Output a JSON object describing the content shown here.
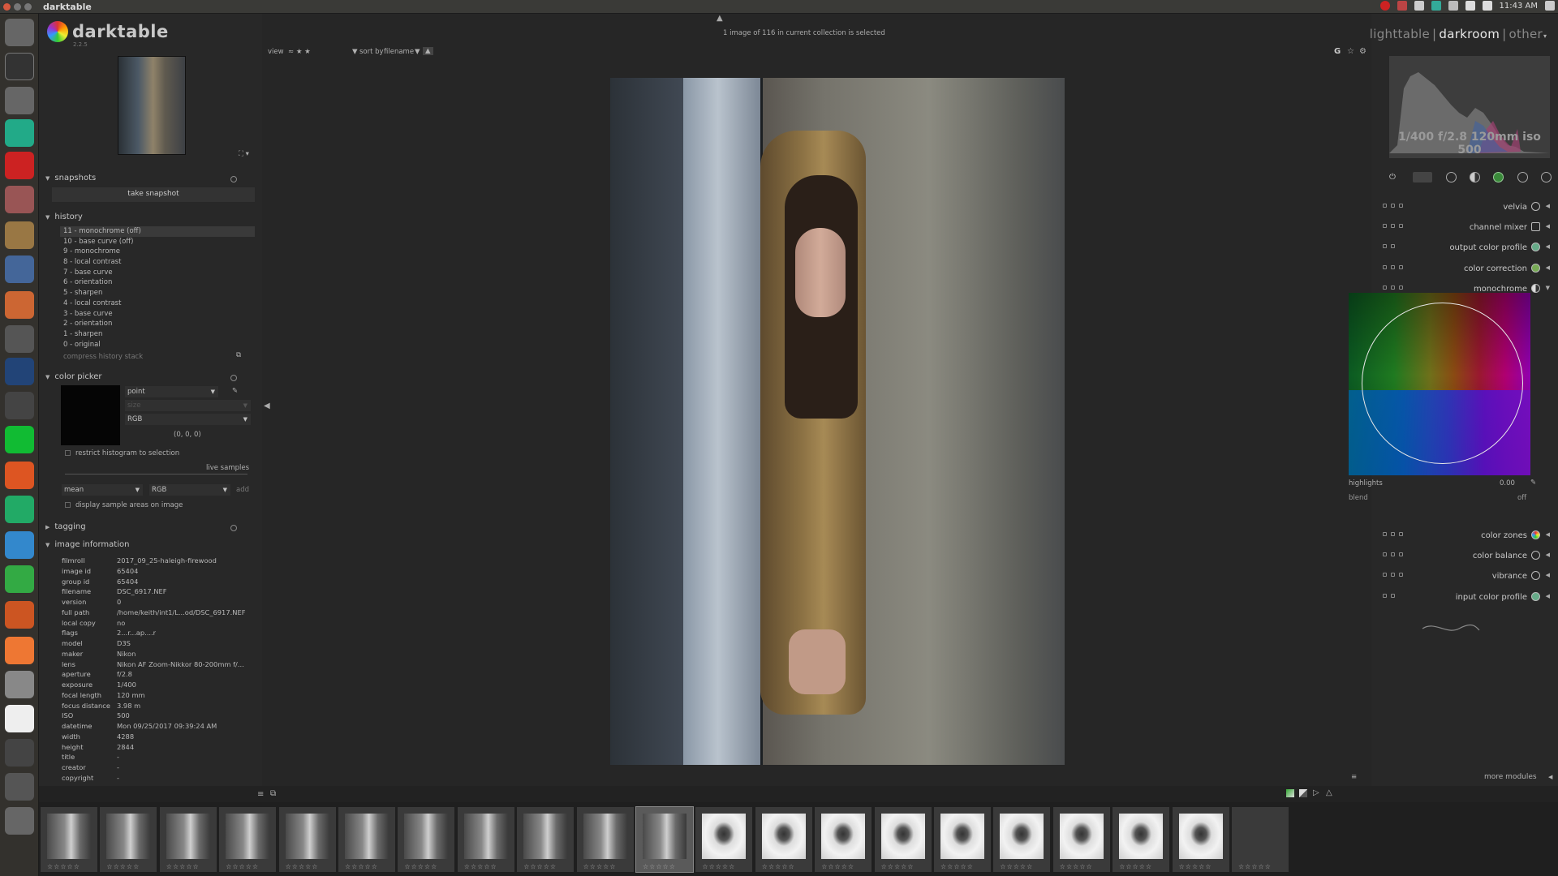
{
  "os": {
    "window_title": "darktable",
    "clock": "11:43 AM"
  },
  "app": {
    "name": "darktable",
    "version": "2.2.5",
    "status": "1 image of 116 in current collection is selected",
    "views": [
      "lighttable",
      "darkroom",
      "other"
    ],
    "active_view": "darkroom"
  },
  "toolbar": {
    "view_label": "view",
    "view_value": "≈ ★ ★",
    "sort_label": "sort by",
    "sort_value": "filename",
    "g_label": "G"
  },
  "snapshots": {
    "title": "snapshots",
    "take_snapshot": "take snapshot"
  },
  "history": {
    "title": "history",
    "items": [
      "11 - monochrome (off)",
      "10 - base curve (off)",
      "9 - monochrome",
      "8 - local contrast",
      "7 - base curve",
      "6 - orientation",
      "5 - sharpen",
      "4 - local contrast",
      "3 - base curve",
      "2 - orientation",
      "1 - sharpen",
      "0 - original"
    ],
    "compress": "compress history stack"
  },
  "color_picker": {
    "title": "color picker",
    "mode": "point",
    "size": "size",
    "colorspace": "RGB",
    "value": "(0, 0, 0)",
    "restrict": "restrict histogram to selection",
    "live_samples": "live samples",
    "stat": "mean",
    "stat_space": "RGB",
    "add": "add",
    "display_samples": "display sample areas on image"
  },
  "tagging": {
    "title": "tagging"
  },
  "image_information": {
    "title": "image information",
    "rows": [
      {
        "k": "filmroll",
        "v": "2017_09_25-haleigh-firewood"
      },
      {
        "k": "image id",
        "v": "65404"
      },
      {
        "k": "group id",
        "v": "65404"
      },
      {
        "k": "filename",
        "v": "DSC_6917.NEF"
      },
      {
        "k": "version",
        "v": "0"
      },
      {
        "k": "full path",
        "v": "/home/keith/int1/L...od/DSC_6917.NEF"
      },
      {
        "k": "local copy",
        "v": "no"
      },
      {
        "k": "flags",
        "v": "2...r...ap....r"
      },
      {
        "k": "model",
        "v": "D3S"
      },
      {
        "k": "maker",
        "v": "Nikon"
      },
      {
        "k": "lens",
        "v": "Nikon AF Zoom-Nikkor 80-200mm f/..."
      },
      {
        "k": "aperture",
        "v": "f/2.8"
      },
      {
        "k": "exposure",
        "v": "1/400"
      },
      {
        "k": "focal length",
        "v": "120 mm"
      },
      {
        "k": "focus distance",
        "v": "3.98 m"
      },
      {
        "k": "ISO",
        "v": "500"
      },
      {
        "k": "datetime",
        "v": "Mon 09/25/2017 09:39:24 AM"
      },
      {
        "k": "width",
        "v": "4288"
      },
      {
        "k": "height",
        "v": "2844"
      },
      {
        "k": "title",
        "v": "-"
      },
      {
        "k": "creator",
        "v": "-"
      },
      {
        "k": "copyright",
        "v": "-"
      }
    ]
  },
  "histogram": {
    "exif": "1/400 f/2.8 120mm iso 500"
  },
  "modules": [
    {
      "name": "velvia",
      "icon": "velvia-icon"
    },
    {
      "name": "channel mixer",
      "icon": "channel-mixer-icon"
    },
    {
      "name": "output color profile",
      "icon": "output-profile-icon"
    },
    {
      "name": "color correction",
      "icon": "color-correction-icon"
    },
    {
      "name": "monochrome",
      "icon": "monochrome-icon"
    }
  ],
  "monochrome": {
    "highlights_label": "highlights",
    "highlights_value": "0.00",
    "blend_label": "blend",
    "blend_value": "off"
  },
  "modules_after": [
    {
      "name": "color zones"
    },
    {
      "name": "color balance"
    },
    {
      "name": "vibrance"
    },
    {
      "name": "input color profile"
    }
  ],
  "more_modules": "more modules",
  "filmstrip": {
    "selected_index": 10,
    "count": 21,
    "stars": "☆☆☆☆☆"
  },
  "colors": {
    "accent": "#e8e8e8",
    "panel": "#282828"
  }
}
